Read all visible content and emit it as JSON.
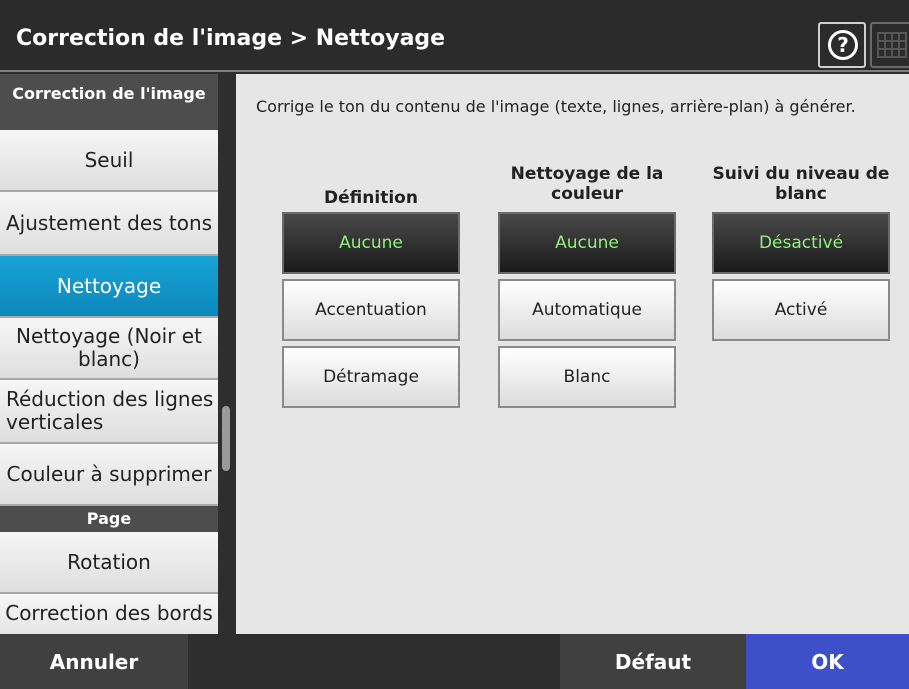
{
  "header": {
    "title": "Correction de l'image > Nettoyage",
    "help_symbol": "?"
  },
  "sidebar": {
    "section1": "Correction de l'image",
    "items": [
      {
        "label": "Seuil"
      },
      {
        "label": "Ajustement des tons"
      },
      {
        "label": "Nettoyage"
      },
      {
        "label": "Nettoyage (Noir et blanc)"
      },
      {
        "label": "Réduction des lignes verticales"
      },
      {
        "label": "Couleur à supprimer"
      }
    ],
    "section2": "Page",
    "items2": [
      {
        "label": "Rotation"
      },
      {
        "label": "Correction des bords"
      }
    ]
  },
  "main": {
    "description": "Corrige le ton du contenu de l'image (texte, lignes, arrière-plan) à générer.",
    "columns": [
      {
        "header": "Définition",
        "options": [
          "Aucune",
          "Accentuation",
          "Détramage"
        ],
        "selected": "Aucune"
      },
      {
        "header": "Nettoyage de la couleur",
        "options": [
          "Aucune",
          "Automatique",
          "Blanc"
        ],
        "selected": "Aucune"
      },
      {
        "header": "Suivi du niveau de blanc",
        "options": [
          "Désactivé",
          "Activé"
        ],
        "selected": "Désactivé"
      }
    ]
  },
  "footer": {
    "cancel": "Annuler",
    "default": "Défaut",
    "ok": "OK"
  },
  "colors": {
    "active_item": "#0d87bb",
    "ok_button": "#3d4fc9",
    "selected_text": "#8ff07a"
  }
}
